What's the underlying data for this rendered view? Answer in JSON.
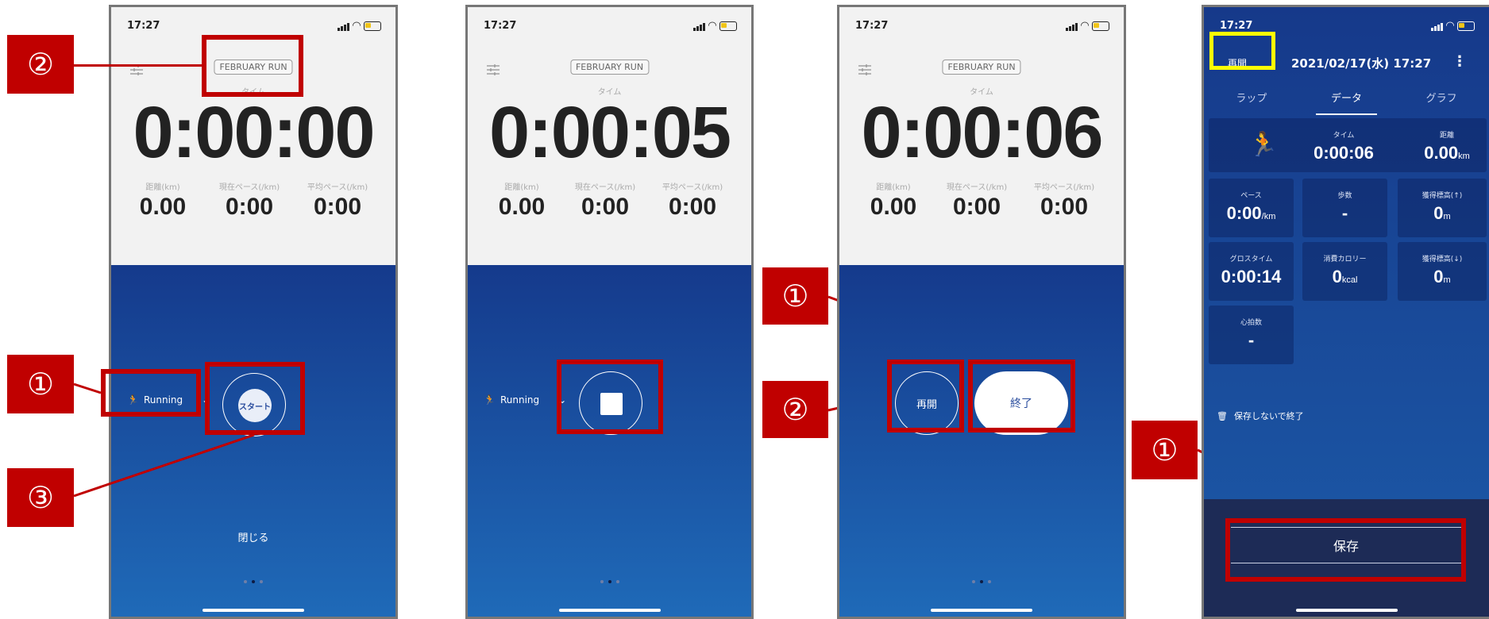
{
  "status": {
    "time": "17:27"
  },
  "screen1": {
    "run_tag": "FEBRUARY RUN",
    "time_label": "タイム",
    "big_time": "0:00:00",
    "stats": [
      {
        "label": "距離(km)",
        "value": "0.00"
      },
      {
        "label": "現在ペース(/km)",
        "value": "0:00"
      },
      {
        "label": "平均ペース(/km)",
        "value": "0:00"
      }
    ],
    "activity": "Running",
    "start_label": "スタート",
    "close_label": "閉じる"
  },
  "screen2": {
    "run_tag": "FEBRUARY RUN",
    "time_label": "タイム",
    "big_time": "0:00:05",
    "stats": [
      {
        "label": "距離(km)",
        "value": "0.00"
      },
      {
        "label": "現在ペース(/km)",
        "value": "0:00"
      },
      {
        "label": "平均ペース(/km)",
        "value": "0:00"
      }
    ],
    "activity": "Running"
  },
  "screen3": {
    "run_tag": "FEBRUARY RUN",
    "time_label": "タイム",
    "big_time": "0:00:06",
    "stats": [
      {
        "label": "距離(km)",
        "value": "0.00"
      },
      {
        "label": "現在ペース(/km)",
        "value": "0:00"
      },
      {
        "label": "平均ペース(/km)",
        "value": "0:00"
      }
    ],
    "resume_label": "再開",
    "finish_label": "終了"
  },
  "screen4": {
    "resume_label": "再開",
    "datetime": "2021/02/17(水) 17:27",
    "tabs": [
      "ラップ",
      "データ",
      "グラフ"
    ],
    "summary": {
      "time_label": "タイム",
      "time": "0:00:06",
      "dist_label": "距離",
      "dist": "0.00",
      "dist_unit": "km"
    },
    "cards": [
      {
        "label": "ペース",
        "value": "0:00",
        "unit": "/km"
      },
      {
        "label": "歩数",
        "value": "-",
        "unit": ""
      },
      {
        "label": "獲得標高(↑)",
        "value": "0",
        "unit": "m"
      },
      {
        "label": "グロスタイム",
        "value": "0:00:14",
        "unit": ""
      },
      {
        "label": "消費カロリー",
        "value": "0",
        "unit": "kcal"
      },
      {
        "label": "獲得標高(↓)",
        "value": "0",
        "unit": "m"
      },
      {
        "label": "心拍数",
        "value": "-",
        "unit": ""
      }
    ],
    "discard_label": "保存しないで終了",
    "save_label": "保存"
  },
  "annotations": {
    "p1_top": "②",
    "p1_mid": "①",
    "p1_bottom": "③",
    "p3_top": "①",
    "p3_bottom": "②",
    "p4": "①"
  },
  "colors": {
    "annotation_red": "#c00000",
    "highlight_yellow": "#ffff00",
    "app_blue": "#1a4a9e"
  }
}
